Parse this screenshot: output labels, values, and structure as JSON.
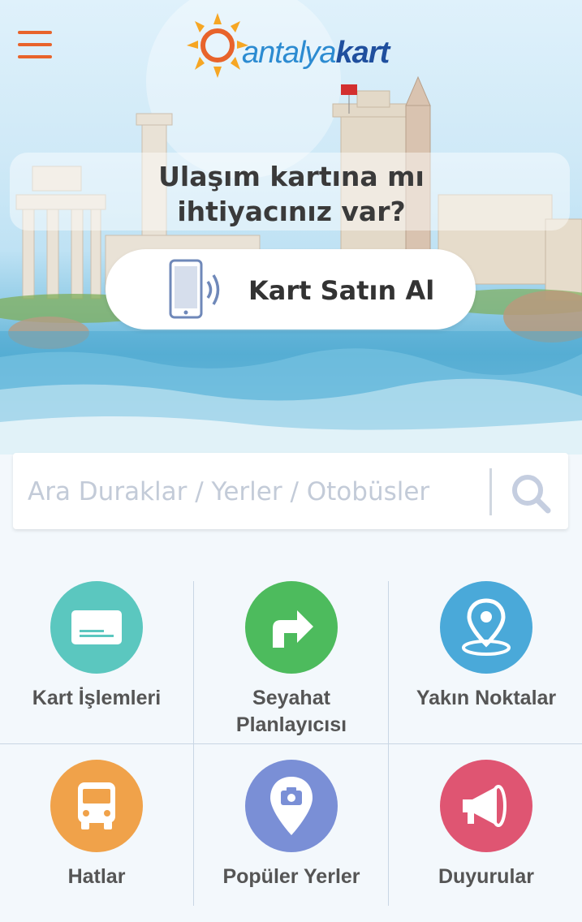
{
  "header": {
    "logo_text_a": "antalya",
    "logo_text_b": "kart"
  },
  "hero": {
    "question": "Ulaşım kartına mı ihtiyacınız var?",
    "buy_button_label": "Kart Satın Al"
  },
  "search": {
    "placeholder": "Ara Duraklar / Yerler / Otobüsler",
    "value": ""
  },
  "menu": [
    {
      "label": "Kart İşlemleri",
      "icon": "card-icon",
      "color": "#5bc7bf"
    },
    {
      "label": "Seyahat Planlayıcısı",
      "icon": "route-arrow-icon",
      "color": "#4dbb5d"
    },
    {
      "label": "Yakın Noktalar",
      "icon": "location-pin-icon",
      "color": "#4aa9d9"
    },
    {
      "label": "Hatlar",
      "icon": "bus-icon",
      "color": "#f0a24a"
    },
    {
      "label": "Popüler Yerler",
      "icon": "camera-pin-icon",
      "color": "#7a8fd6"
    },
    {
      "label": "Duyurular",
      "icon": "megaphone-icon",
      "color": "#df5572"
    }
  ],
  "colors": {
    "accent": "#e8632b",
    "brand_blue": "#1f4f9e"
  }
}
